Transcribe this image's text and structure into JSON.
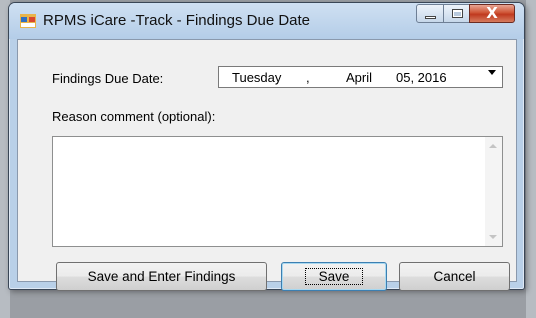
{
  "window": {
    "title": "RPMS iCare -Track - Findings Due Date",
    "close_glyph": "X"
  },
  "form": {
    "due_date_label": "Findings Due Date:",
    "due_date": {
      "weekday": "Tuesday",
      "sep": ",",
      "month": "April",
      "day_year": "05, 2016"
    },
    "reason_label": "Reason comment (optional):",
    "reason_value": ""
  },
  "buttons": {
    "save_enter": "Save and Enter Findings",
    "save": "Save",
    "cancel": "Cancel"
  },
  "icons": {
    "app": "app-window-icon",
    "minimize": "minimize-icon",
    "maximize": "maximize-icon",
    "close": "close-icon",
    "dropdown": "chevron-down-icon"
  },
  "colors": {
    "titlebar": "#b9d0e8",
    "client_bg": "#f0f0f0",
    "close_button": "#c0391f",
    "default_button_border": "#3c7fb1"
  }
}
